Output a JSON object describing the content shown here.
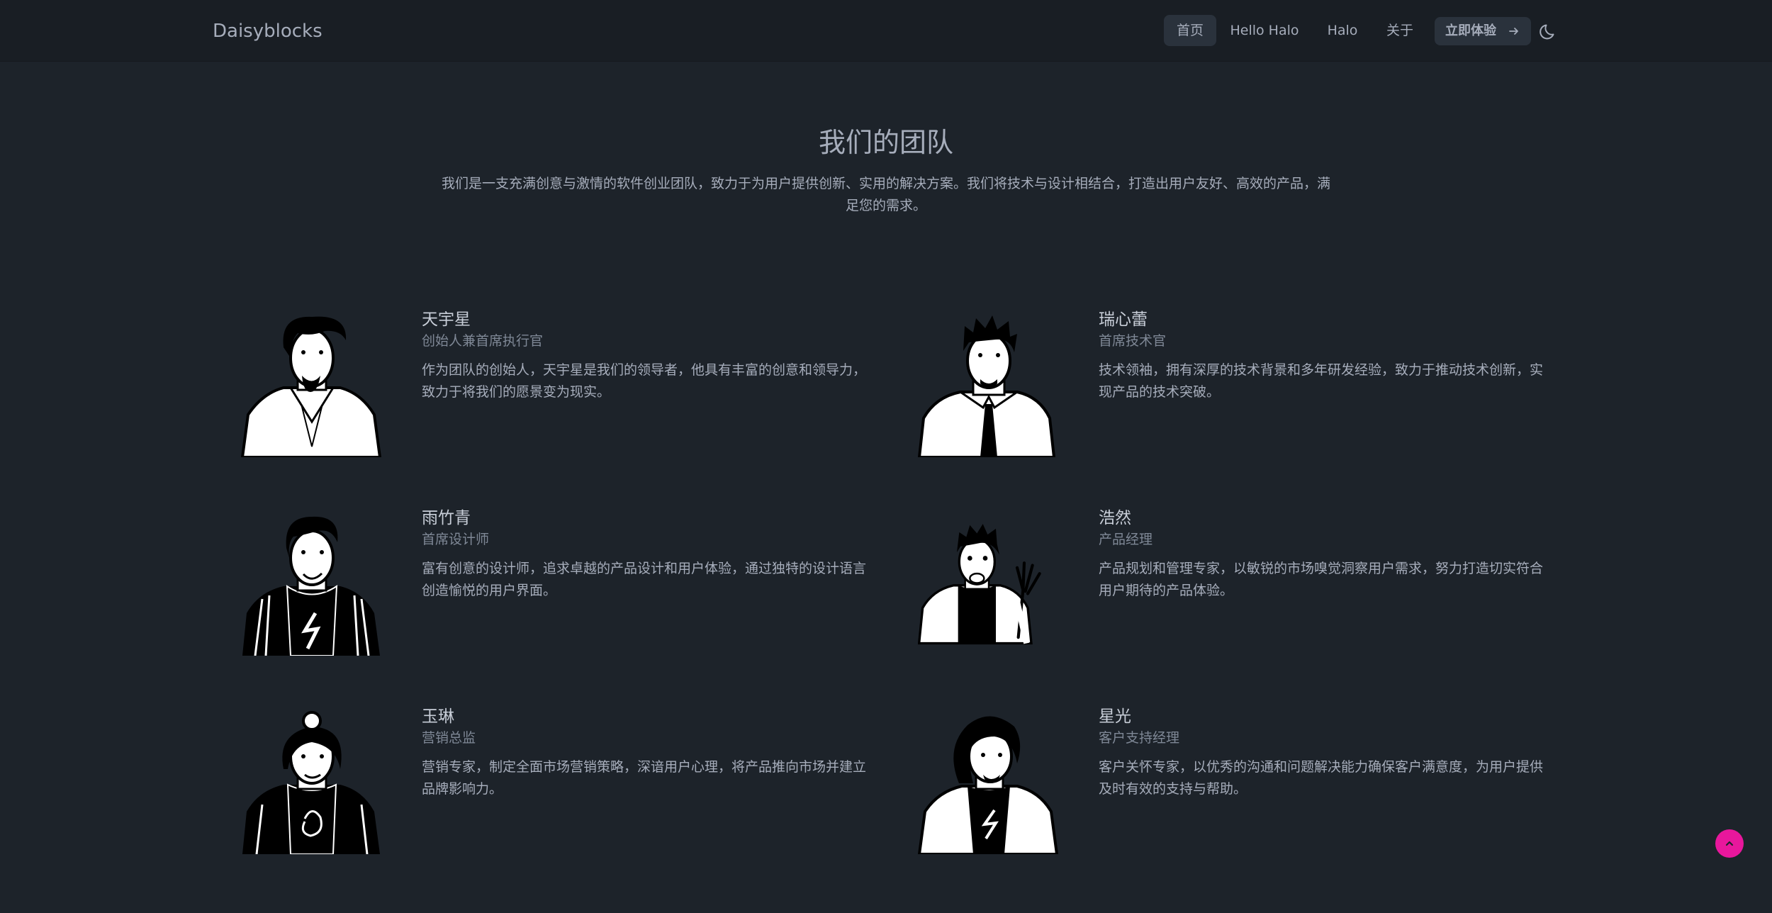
{
  "navbar": {
    "brand": "Daisyblocks",
    "items": [
      {
        "label": "首页"
      },
      {
        "label": "Hello Halo"
      },
      {
        "label": "Halo"
      },
      {
        "label": "关于"
      }
    ],
    "cta_label": "立即体验",
    "icons": {
      "cta": "arrow-right-icon",
      "theme": "moon-icon"
    }
  },
  "header": {
    "title": "我们的团队",
    "description": "我们是一支充满创意与激情的软件创业团队，致力于为用户提供创新、实用的解决方案。我们将技术与设计相结合，打造出用户友好、高效的产品，满足您的需求。"
  },
  "team": [
    {
      "name": "天宇星",
      "role": "创始人兼首席执行官",
      "bio": "作为团队的创始人，天宇星是我们的领导者，他具有丰富的创意和领导力，致力于将我们的愿景变为现实。"
    },
    {
      "name": "瑞心蕾",
      "role": "首席技术官",
      "bio": "技术领袖，拥有深厚的技术背景和多年研发经验，致力于推动技术创新，实现产品的技术突破。"
    },
    {
      "name": "雨竹青",
      "role": "首席设计师",
      "bio": "富有创意的设计师，追求卓越的产品设计和用户体验，通过独特的设计语言创造愉悦的用户界面。"
    },
    {
      "name": "浩然",
      "role": "产品经理",
      "bio": "产品规划和管理专家，以敏锐的市场嗅觉洞察用户需求，努力打造切实符合用户期待的产品体验。"
    },
    {
      "name": "玉琳",
      "role": "营销总监",
      "bio": "营销专家，制定全面市场营销策略，深谙用户心理，将产品推向市场并建立品牌影响力。"
    },
    {
      "name": "星光",
      "role": "客户支持经理",
      "bio": "客户关怀专家，以优秀的沟通和问题解决能力确保客户满意度，为用户提供及时有效的支持与帮助。"
    }
  ],
  "colors": {
    "background": "#1d232a",
    "navbar": "#191e24",
    "accent": "#e8179c"
  }
}
